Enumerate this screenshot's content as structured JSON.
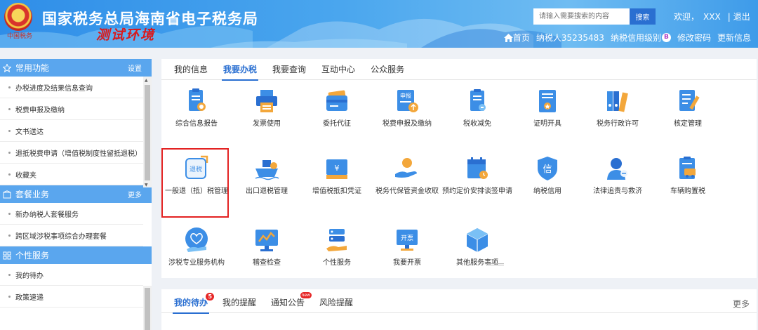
{
  "header": {
    "site_title": "国家税务总局海南省电子税务局",
    "env_tag": "测试环境",
    "emblem_text": "中国税务",
    "search_placeholder": "请输入需要搜索的内容",
    "search_button": "搜索",
    "welcome": "欢迎，",
    "user": "XXX",
    "separator": "|",
    "logout": "退出",
    "home": "首页",
    "taxpayer": "纳税人35235483",
    "credit_level_label": "纳税信用级别",
    "credit_level": "B",
    "change_password": "修改密码",
    "update_info": "更新信息"
  },
  "sidebar": {
    "section1": {
      "title": "常用功能",
      "extra": "设置",
      "items": [
        "办税进度及结果信息查询",
        "税费申报及缴纳",
        "文书送达",
        "退抵税费申请（增值税制度性留抵退税）（...",
        "收藏夹"
      ]
    },
    "section2": {
      "title": "套餐业务",
      "extra": "更多",
      "items": [
        "新办纳税人套餐服务",
        "跨区域涉税事项综合办理套餐"
      ]
    },
    "section3": {
      "title": "个性服务",
      "items": [
        "我的待办",
        "政策速递"
      ]
    }
  },
  "tabs": [
    "我的信息",
    "我要办税",
    "我要查询",
    "互动中心",
    "公众服务"
  ],
  "active_tab": 1,
  "services": [
    {
      "label": "综合信息报告",
      "icon": "report-icon"
    },
    {
      "label": "发票使用",
      "icon": "printer-icon"
    },
    {
      "label": "委托代征",
      "icon": "wallet-icon"
    },
    {
      "label": "税费申报及缴纳",
      "icon": "declare-icon",
      "icon_text": "申报"
    },
    {
      "label": "税收减免",
      "icon": "tax-relief-icon"
    },
    {
      "label": "证明开具",
      "icon": "certificate-icon"
    },
    {
      "label": "税务行政许可",
      "icon": "binders-icon"
    },
    {
      "label": "核定管理",
      "icon": "checklist-icon"
    },
    {
      "label": "一般退（抵）税管理",
      "icon": "tax-refund-icon",
      "icon_text": "退税"
    },
    {
      "label": "出口退税管理",
      "icon": "ship-icon"
    },
    {
      "label": "增值税抵扣凭证",
      "icon": "voucher-icon",
      "icon_text": "¥"
    },
    {
      "label": "税务代保管资金收取",
      "icon": "hand-coin-icon"
    },
    {
      "label": "预约定价安排谈签申请",
      "icon": "calendar-icon"
    },
    {
      "label": "纳税信用",
      "icon": "credit-shield-icon",
      "icon_text": "信"
    },
    {
      "label": "法律追责与救济",
      "icon": "legal-icon"
    },
    {
      "label": "车辆购置税",
      "icon": "vehicle-tax-icon"
    },
    {
      "label": "涉税专业服务机构",
      "icon": "heart-hand-icon"
    },
    {
      "label": "稽查检查",
      "icon": "monitor-chart-icon"
    },
    {
      "label": "个性服务",
      "icon": "personal-service-icon"
    },
    {
      "label": "我要开票",
      "icon": "invoice-icon",
      "icon_text": "开票"
    },
    {
      "label": "其他服务事项",
      "icon": "box-icon"
    }
  ],
  "bottom_tabs": [
    "我的待办",
    "我的提醒",
    "通知公告",
    "风险提醒"
  ],
  "todo_count": "5",
  "new_badge": "new",
  "bottom_more": "更多",
  "colors": {
    "primary": "#2a6fd1",
    "header": "#3d98ea",
    "sidebar_head": "#5aa6ee",
    "highlight": "#e32222"
  }
}
